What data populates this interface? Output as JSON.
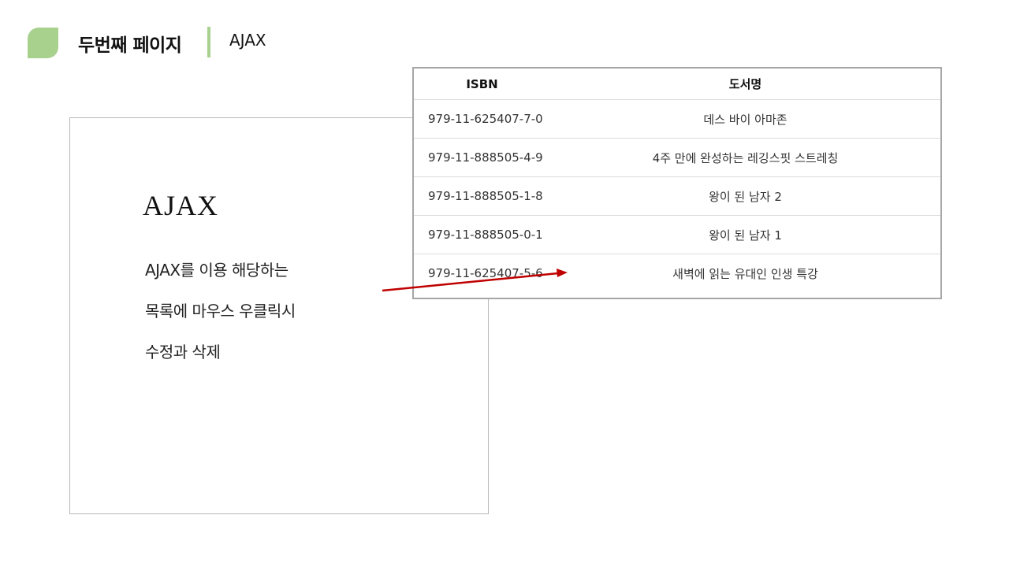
{
  "header": {
    "title": "두번째 페이지",
    "subtitle": "AJAX",
    "accent_color": "#a9d18e"
  },
  "card": {
    "title": "AJAX",
    "lines": [
      "AJAX를 이용 해당하는",
      "목록에 마우스 우클릭시",
      "수정과 삭제"
    ]
  },
  "table": {
    "columns": [
      "ISBN",
      "도서명"
    ],
    "rows": [
      {
        "isbn": "979-11-625407-7-0",
        "title": "데스 바이 아마존"
      },
      {
        "isbn": "979-11-888505-4-9",
        "title": "4주 만에 완성하는 레깅스핏 스트레칭"
      },
      {
        "isbn": "979-11-888505-1-8",
        "title": "왕이 된 남자 2"
      },
      {
        "isbn": "979-11-888505-0-1",
        "title": "왕이 된 남자 1"
      },
      {
        "isbn": "979-11-625407-5-6",
        "title": "새벽에 읽는 유대인 인생 특강"
      }
    ]
  },
  "arrow_color": "#c00000"
}
